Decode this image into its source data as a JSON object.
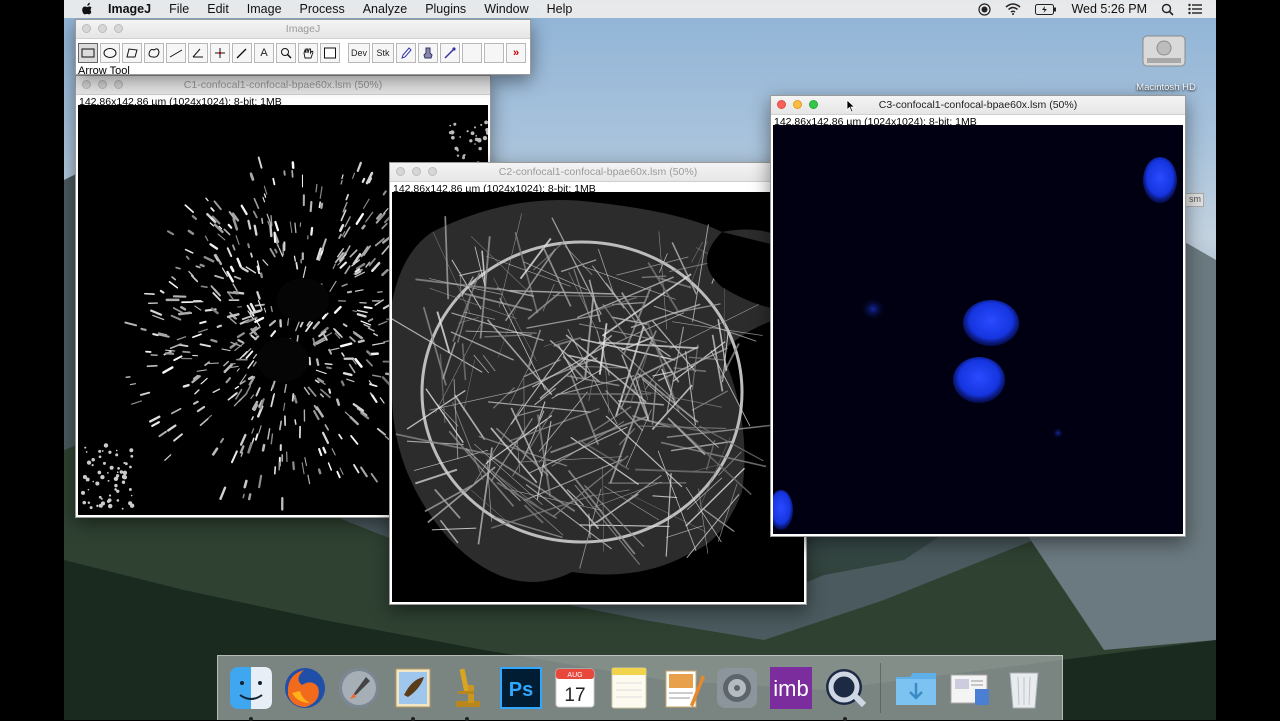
{
  "menubar": {
    "app_name": "ImageJ",
    "items": [
      "File",
      "Edit",
      "Image",
      "Process",
      "Analyze",
      "Plugins",
      "Window",
      "Help"
    ],
    "clock": "Wed 5:26 PM"
  },
  "desktop": {
    "hd_label": "Macintosh HD"
  },
  "imagej_main": {
    "title": "ImageJ",
    "tools": {
      "dev": "Dev",
      "stk": "Stk",
      "more": "»",
      "text_tool": "A"
    },
    "status": "Arrow Tool"
  },
  "windows": {
    "c1": {
      "title": "C1-confocal1-confocal-bpae60x.lsm (50%)",
      "info": "142.86x142.86 µm (1024x1024); 8-bit; 1MB"
    },
    "c2": {
      "title": "C2-confocal1-confocal-bpae60x.lsm (50%)",
      "info": "142.86x142.86 µm (1024x1024); 8-bit; 1MB"
    },
    "c3": {
      "title": "C3-confocal1-confocal-bpae60x.lsm (50%)",
      "info": "142.86x142.86 µm (1024x1024); 8-bit; 1MB",
      "partial_behind": "sm"
    }
  },
  "dock": {
    "calendar_month": "AUG",
    "calendar_day": "17",
    "ps_label": "Ps",
    "imb_label": "imb"
  },
  "colors": {
    "nucleus_blue": "#1a3cff",
    "actin_white": "#e8e8e8",
    "menubar_bg": "#ececec"
  }
}
